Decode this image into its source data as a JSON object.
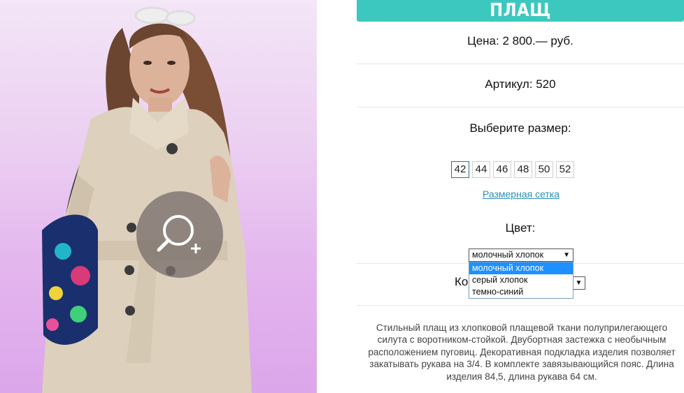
{
  "product": {
    "title": "ПЛАЩ",
    "price": "Цена: 2 800.— руб.",
    "article": "Артикул: 520",
    "size_heading": "Выберите размер:",
    "sizes": [
      "42",
      "44",
      "46",
      "48",
      "50",
      "52"
    ],
    "selected_size": "42",
    "size_chart_link": "Размерная сетка",
    "color_heading": "Цвет:",
    "color_selected": "молочный хлопок",
    "color_options": [
      "молочный хлопок",
      "серый хлопок",
      "темно-синий"
    ],
    "quantity_label_visible": "Ко",
    "description": "Стильный плащ из хлопковой плащевой ткани полуприлегающего силута с воротником-стойкой. Двубортная застежка с необычным расположением пуговиц. Декоративная подкладка изделия позволяет закатывать рукава на 3/4. В комплекте завязывающийся пояс. Длина изделия 84,5, длина рукава 64 см."
  },
  "colors": {
    "accent": "#3cc8bf",
    "link": "#2a8fb3",
    "dropdown_highlight": "#1e90ff"
  },
  "icons": {
    "zoom": "magnifier-plus-icon",
    "select_arrow": "▼"
  }
}
